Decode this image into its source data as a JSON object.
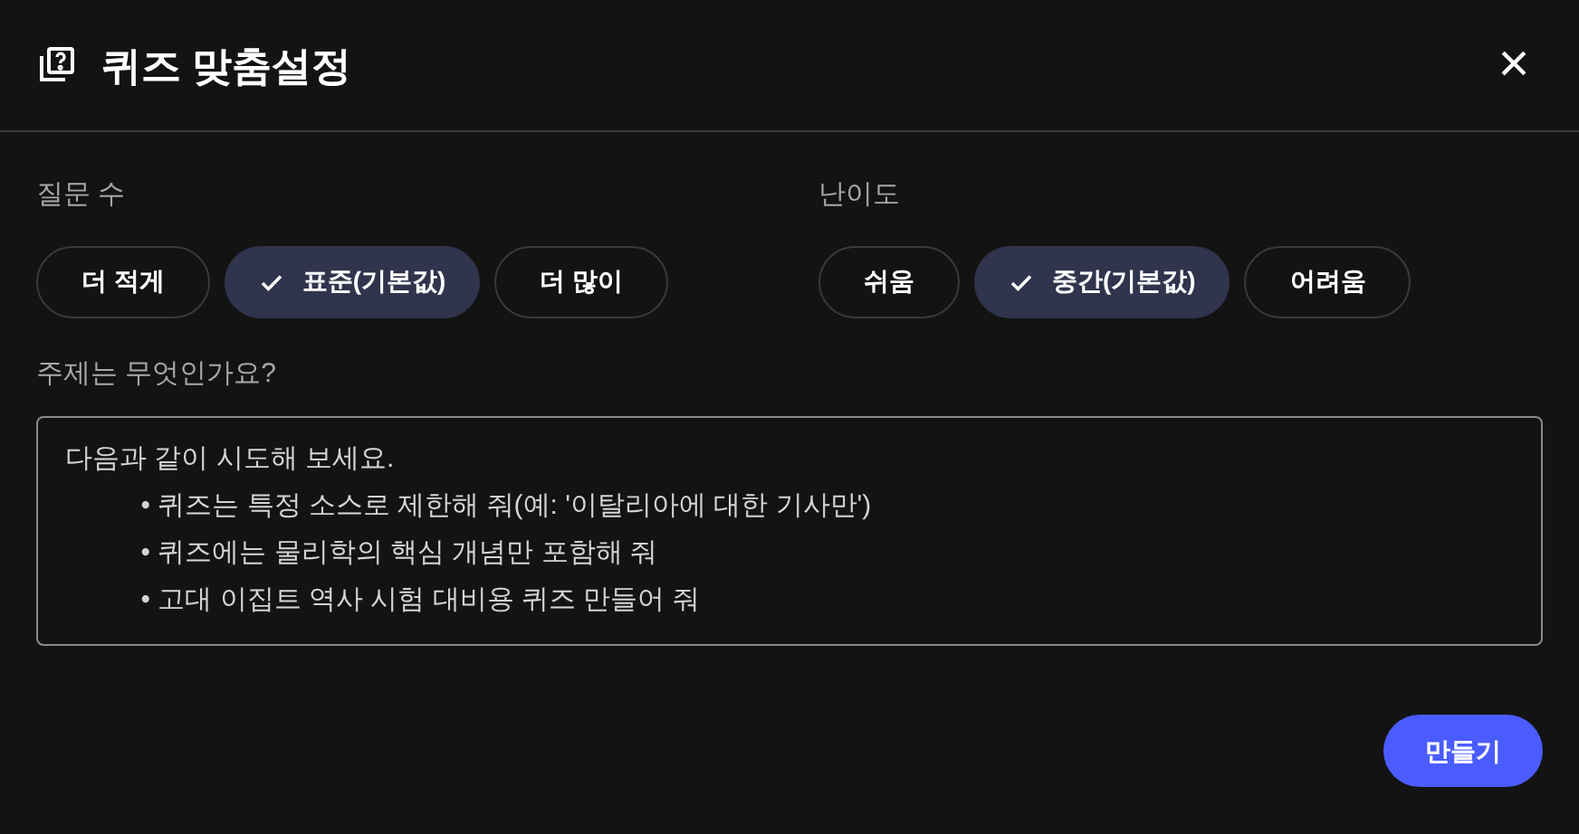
{
  "dialog": {
    "title": "퀴즈 맞춤설정",
    "close": "×"
  },
  "question_count": {
    "label": "질문 수",
    "options": [
      {
        "label": "더 적게",
        "selected": false
      },
      {
        "label": "표준(기본값)",
        "selected": true
      },
      {
        "label": "더 많이",
        "selected": false
      }
    ]
  },
  "difficulty": {
    "label": "난이도",
    "options": [
      {
        "label": "쉬움",
        "selected": false
      },
      {
        "label": "중간(기본값)",
        "selected": true
      },
      {
        "label": "어려움",
        "selected": false
      }
    ]
  },
  "topic": {
    "label": "주제는 무엇인가요?",
    "placeholder": "다음과 같이 시도해 보세요.\n          • 퀴즈는 특정 소스로 제한해 줘(예: '이탈리아에 대한 기사만')\n          • 퀴즈에는 물리학의 핵심 개념만 포함해 줘\n          • 고대 이집트 역사 시험 대비용 퀴즈 만들어 줘"
  },
  "create_button": "만들기"
}
